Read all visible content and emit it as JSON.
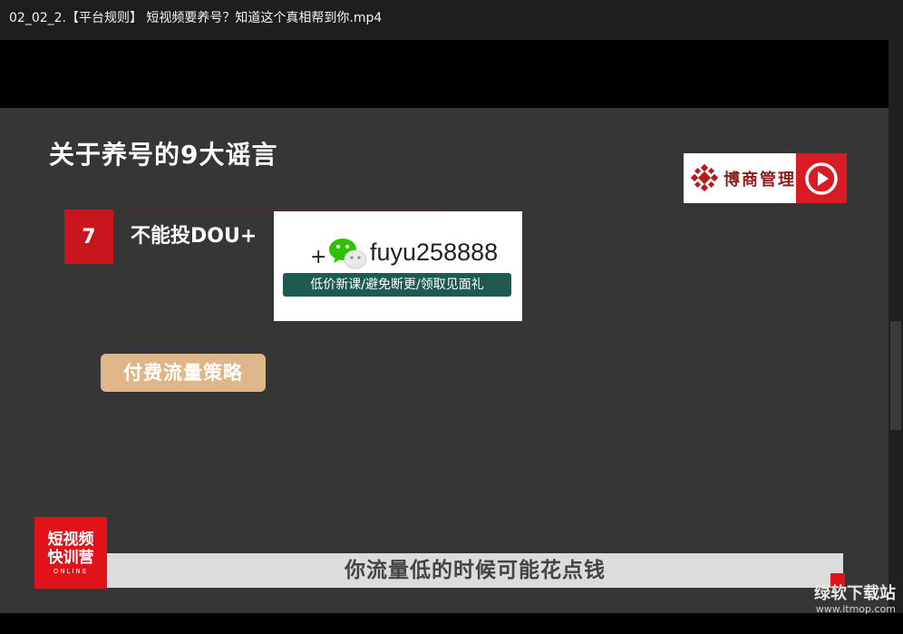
{
  "window": {
    "title": "02_02_2.【平台规则】 短视频要养号？知道这个真相帮到你.mp4"
  },
  "slide": {
    "title": "关于养号的9大谣言",
    "myth": {
      "number": "7",
      "text": "不能投DOU+"
    },
    "tag": "付费流量策略",
    "logo": {
      "brand": "博商管理"
    },
    "badge": {
      "line1": "短视频",
      "line2": "快训营",
      "line3": "ONLINE"
    },
    "subtitle": "你流量低的时候可能花点钱"
  },
  "overlay": {
    "plus": "+",
    "wechat_id": "fuyu258888",
    "banner": "低价新课/避免断更/领取见面礼"
  },
  "watermark": {
    "line1": "绿软下载站",
    "line2": "www.itmop.com"
  },
  "colors": {
    "accent_red": "#d91c24",
    "tag_gold": "#deb689",
    "banner_green": "#1e5953",
    "wechat_green": "#2dc100"
  },
  "icons": {
    "logo_mark": "knot-pattern-icon",
    "play": "play-circle-icon",
    "wechat": "wechat-icon"
  }
}
